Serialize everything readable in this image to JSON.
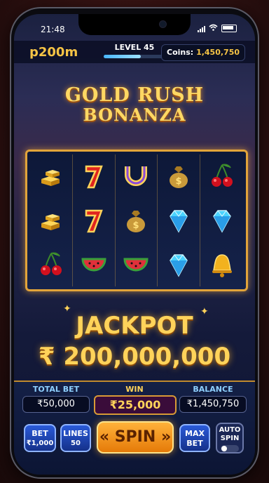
{
  "status": {
    "time": "21:48"
  },
  "header": {
    "logo": "p200m",
    "level": "LEVEL 45",
    "level_progress": 0.6,
    "coins_label": "Coins:",
    "coins_value": "1,450,750"
  },
  "game": {
    "title_line1": "GOLD RUSH",
    "title_line2": "BONANZA"
  },
  "reels": [
    [
      "gold-bars",
      "seven",
      "horseshoe",
      "money-bag",
      "cherries"
    ],
    [
      "gold-bars",
      "seven",
      "money-bag",
      "diamond",
      "diamond"
    ],
    [
      "cherries",
      "watermelon",
      "watermelon",
      "diamond",
      "bell"
    ]
  ],
  "jackpot": {
    "label": "JACKPOT",
    "amount": "₹ 200,000,000"
  },
  "controls": {
    "total_bet_label": "TOTAL BET",
    "total_bet_value": "₹50,000",
    "win_label": "WIN",
    "win_value": "₹25,000",
    "balance_label": "BALANCE",
    "balance_value": "₹1,450,750",
    "bet_label": "BET",
    "bet_value": "₹1,000",
    "lines_label": "LINES",
    "lines_value": "50",
    "spin_label": "« SPIN »",
    "max_bet_line1": "MAX",
    "max_bet_line2": "BET",
    "auto_spin_line1": "AUTO",
    "auto_spin_line2": "SPIN"
  },
  "colors": {
    "gold": "#f6c445",
    "accent_blue": "#49b6ff",
    "win_bg": "#3a0c3a"
  }
}
